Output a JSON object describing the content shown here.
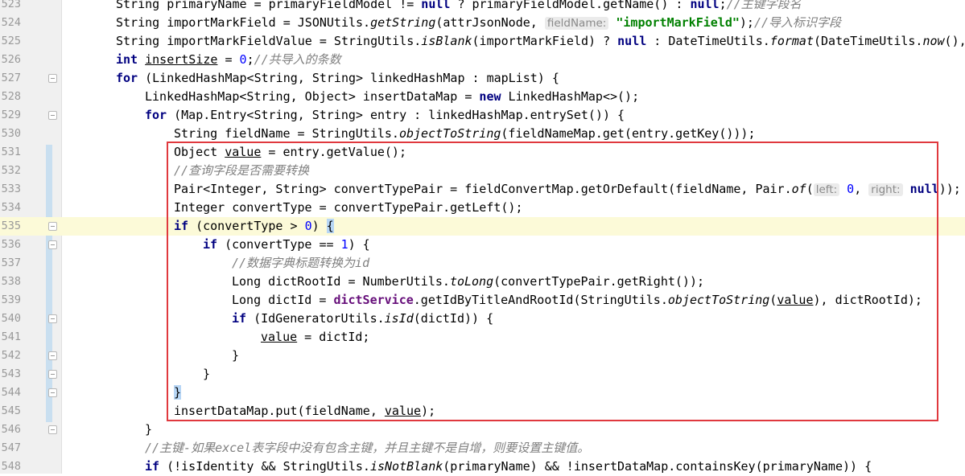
{
  "editor": {
    "highlight_color": "#e0393e",
    "lines": [
      {
        "num": "523"
      },
      {
        "num": "524"
      },
      {
        "num": "525"
      },
      {
        "num": "526"
      },
      {
        "num": "527"
      },
      {
        "num": "528"
      },
      {
        "num": "529"
      },
      {
        "num": "530"
      },
      {
        "num": "531"
      },
      {
        "num": "532"
      },
      {
        "num": "533"
      },
      {
        "num": "534"
      },
      {
        "num": "535"
      },
      {
        "num": "536"
      },
      {
        "num": "537"
      },
      {
        "num": "538"
      },
      {
        "num": "539"
      },
      {
        "num": "540"
      },
      {
        "num": "541"
      },
      {
        "num": "542"
      },
      {
        "num": "543"
      },
      {
        "num": "544"
      },
      {
        "num": "545"
      },
      {
        "num": "546"
      },
      {
        "num": "547"
      },
      {
        "num": "548"
      }
    ],
    "t": {
      "l523a": "String primaryName = primaryFieldModel != ",
      "l523b": "null",
      "l523c": " ? primaryFieldModel.getName() : ",
      "l523d": "null",
      "l523e": ";",
      "l523f": "//主键字段名",
      "l524a": "String importMarkField = JSONUtils.",
      "l524b": "getString",
      "l524c": "(attrJsonNode, ",
      "l524h": "fieldName:",
      "l524d": "\"importMarkField\"",
      "l524e": ");",
      "l524f": "//导入标识字段",
      "l525a": "String importMarkFieldValue = StringUtils.",
      "l525b": "isBlank",
      "l525c": "(importMarkField) ? ",
      "l525d": "null",
      "l525e": " : DateTimeUtils.",
      "l525f": "format",
      "l525g": "(DateTimeUtils.",
      "l525h": "now",
      "l525i": "(),",
      "l526a": "int",
      "l526b": "insertSize",
      "l526c": " = ",
      "l526d": "0",
      "l526e": ";",
      "l526f": "//共导入的条数",
      "l527a": "for",
      "l527b": " (LinkedHashMap<String, String> linkedHashMap : mapList) {",
      "l528a": "LinkedHashMap<String, Object> insertDataMap = ",
      "l528b": "new",
      "l528c": " LinkedHashMap<>();",
      "l529a": "for",
      "l529b": " (Map.Entry<String, String> entry : linkedHashMap.entrySet()) {",
      "l530a": "String fieldName = StringUtils.",
      "l530b": "objectToString",
      "l530c": "(fieldNameMap.get(entry.getKey()));",
      "l531a": "Object ",
      "l531b": "value",
      "l531c": " = entry.getValue();",
      "l532a": "//查询字段是否需要转换",
      "l533a": "Pair<Integer, String> convertTypePair = fieldConvertMap.getOrDefault(fieldName, Pair.",
      "l533b": "of",
      "l533c": "(",
      "l533h1": "left:",
      "l533d": "0",
      "l533e": ", ",
      "l533h2": "right:",
      "l533f": "null",
      "l533g": "));",
      "l534a": "Integer convertType = convertTypePair.getLeft();",
      "l535a": "if",
      "l535b": " (convertType > ",
      "l535c": "0",
      "l535d": ") ",
      "l535e": "{",
      "l536a": "if",
      "l536b": " (convertType == ",
      "l536c": "1",
      "l536d": ") {",
      "l537a": "//数据字典标题转换为id",
      "l538a": "Long dictRootId = NumberUtils.",
      "l538b": "toLong",
      "l538c": "(convertTypePair.getRight());",
      "l539a": "Long dictId = ",
      "l539b": "dictService",
      "l539c": ".getIdByTitleAndRootId(StringUtils.",
      "l539d": "objectToString",
      "l539e": "(",
      "l539f": "value",
      "l539g": "), dictRootId);",
      "l540a": "if",
      "l540b": " (IdGeneratorUtils.",
      "l540c": "isId",
      "l540d": "(dictId)) {",
      "l541a": "value",
      "l541b": " = dictId;",
      "l542a": "}",
      "l543a": "}",
      "l544a": "}",
      "l545a": "insertDataMap.put(fieldName, ",
      "l545b": "value",
      "l545c": ");",
      "l546a": "}",
      "l547a": "//主键-如果excel表字段中没有包含主键，并且主键不是自增，则要设置主键值。",
      "l548a": "if",
      "l548b": " (!isIdentity && StringUtils.",
      "l548c": "isNotBlank",
      "l548d": "(primaryName) && !insertDataMap.containsKey(primaryName)) {"
    }
  }
}
